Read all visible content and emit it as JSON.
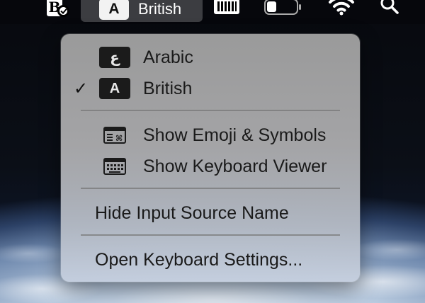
{
  "menubar": {
    "input_source": {
      "badge": "A",
      "label": "British"
    },
    "icons": [
      "app-icon",
      "keyboard-icon",
      "battery-icon",
      "wifi-icon",
      "search-icon"
    ]
  },
  "menu": {
    "languages": [
      {
        "badge": "ع",
        "label": "Arabic",
        "checked": false
      },
      {
        "badge": "A",
        "label": "British",
        "checked": true
      }
    ],
    "check_mark": "✓",
    "tools": [
      {
        "icon": "emoji-symbols-icon",
        "label": "Show Emoji & Symbols"
      },
      {
        "icon": "keyboard-viewer-icon",
        "label": "Show Keyboard Viewer"
      }
    ],
    "hide_name_label": "Hide Input Source Name",
    "open_settings_label": "Open Keyboard Settings..."
  }
}
